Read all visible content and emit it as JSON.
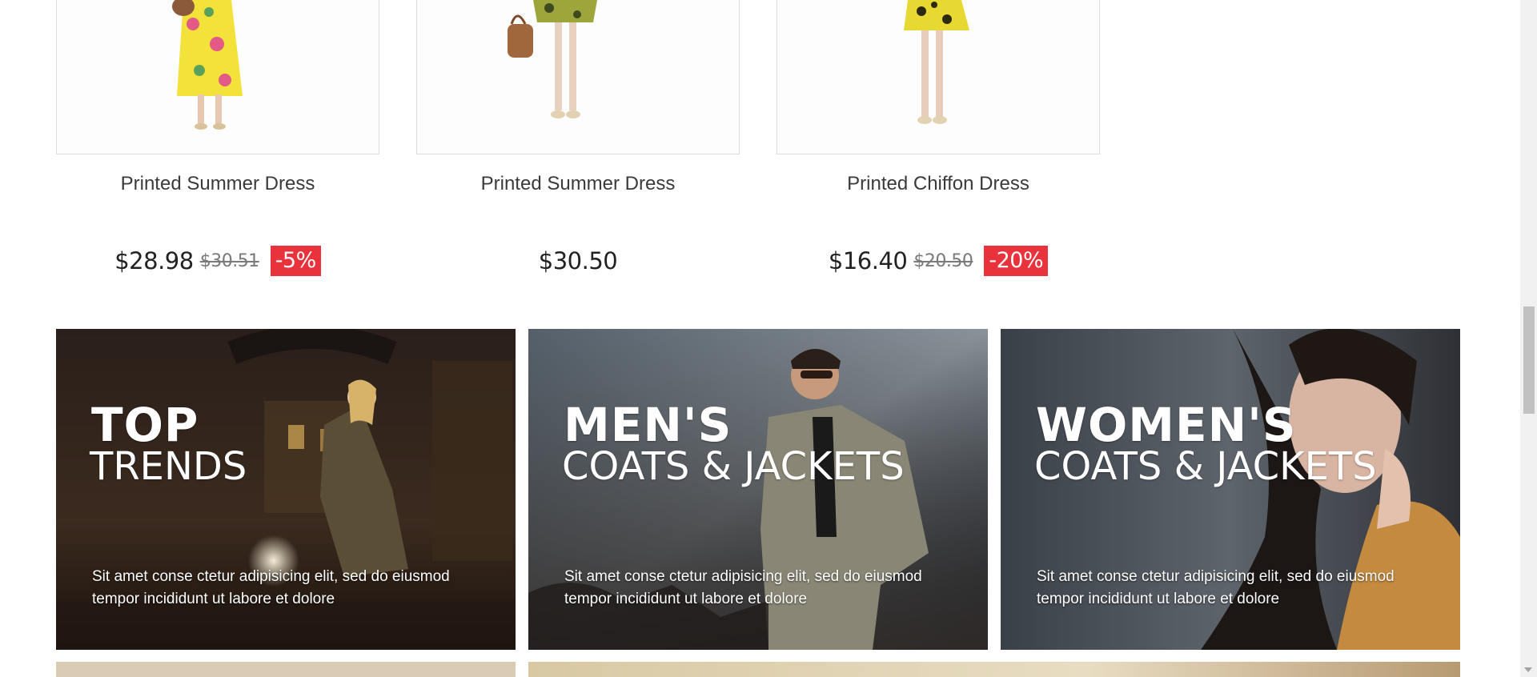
{
  "products": [
    {
      "title": "Printed Summer Dress",
      "price": "$28.98",
      "old_price": "$30.51",
      "discount": "-5%"
    },
    {
      "title": "Printed Summer Dress",
      "price": "$30.50",
      "old_price": "",
      "discount": ""
    },
    {
      "title": "Printed Chiffon Dress",
      "price": "$16.40",
      "old_price": "$20.50",
      "discount": "-20%"
    }
  ],
  "banners": [
    {
      "line1": "TOP",
      "line2": "TRENDS",
      "desc": "Sit amet conse ctetur adipisicing elit, sed do eiusmod tempor incididunt ut labore et dolore"
    },
    {
      "line1": "MEN'S",
      "line2": "COATS & JACKETS",
      "desc": "Sit amet conse ctetur adipisicing elit, sed do eiusmod tempor incididunt ut labore et dolore"
    },
    {
      "line1": "WOMEN'S",
      "line2": "COATS & JACKETS",
      "desc": "Sit amet conse ctetur adipisicing elit, sed do eiusmod tempor incididunt ut labore et dolore"
    }
  ],
  "colors": {
    "discount_badge": "#e8323c",
    "banner_text": "#ffffff",
    "page_bg": "#ffffff"
  }
}
